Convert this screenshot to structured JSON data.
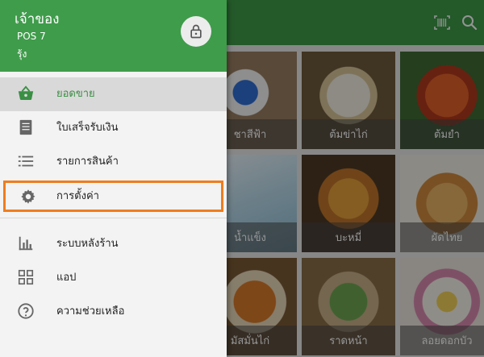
{
  "drawer": {
    "owner_name": "เจ้าของ",
    "pos_name": "POS 7",
    "store_name": "รุ้ง",
    "lock_icon": "lock-icon",
    "items": [
      {
        "label": "ยอดขาย",
        "icon": "basket-icon",
        "active": true
      },
      {
        "label": "ใบเสร็จรับเงิน",
        "icon": "receipt-icon"
      },
      {
        "label": "รายการสินค้า",
        "icon": "list-icon"
      },
      {
        "label": "การตั้งค่า",
        "icon": "gear-icon",
        "highlighted": true
      },
      {
        "label": "ระบบหลังร้าน",
        "icon": "bar-chart-icon"
      },
      {
        "label": "แอป",
        "icon": "apps-icon"
      },
      {
        "label": "ความช่วยเหลือ",
        "icon": "help-icon"
      }
    ]
  },
  "app_bar": {
    "actions": [
      "barcode-scan-icon",
      "search-icon"
    ]
  },
  "products": [
    {
      "name": "ชาสีฟ้า"
    },
    {
      "name": "ต้มข่าไก่"
    },
    {
      "name": "ต้มยำ"
    },
    {
      "name": "น้ำแข็ง"
    },
    {
      "name": "บะหมี่"
    },
    {
      "name": "ผัดไทย"
    },
    {
      "name": "มัสมั่นไก่"
    },
    {
      "name": "ราดหน้า"
    },
    {
      "name": "ลอยดอกบัว"
    }
  ],
  "colors": {
    "brand_green": "#3f9c4b",
    "active_label": "#3a8f44",
    "highlight_outline": "#ef7d1e"
  }
}
